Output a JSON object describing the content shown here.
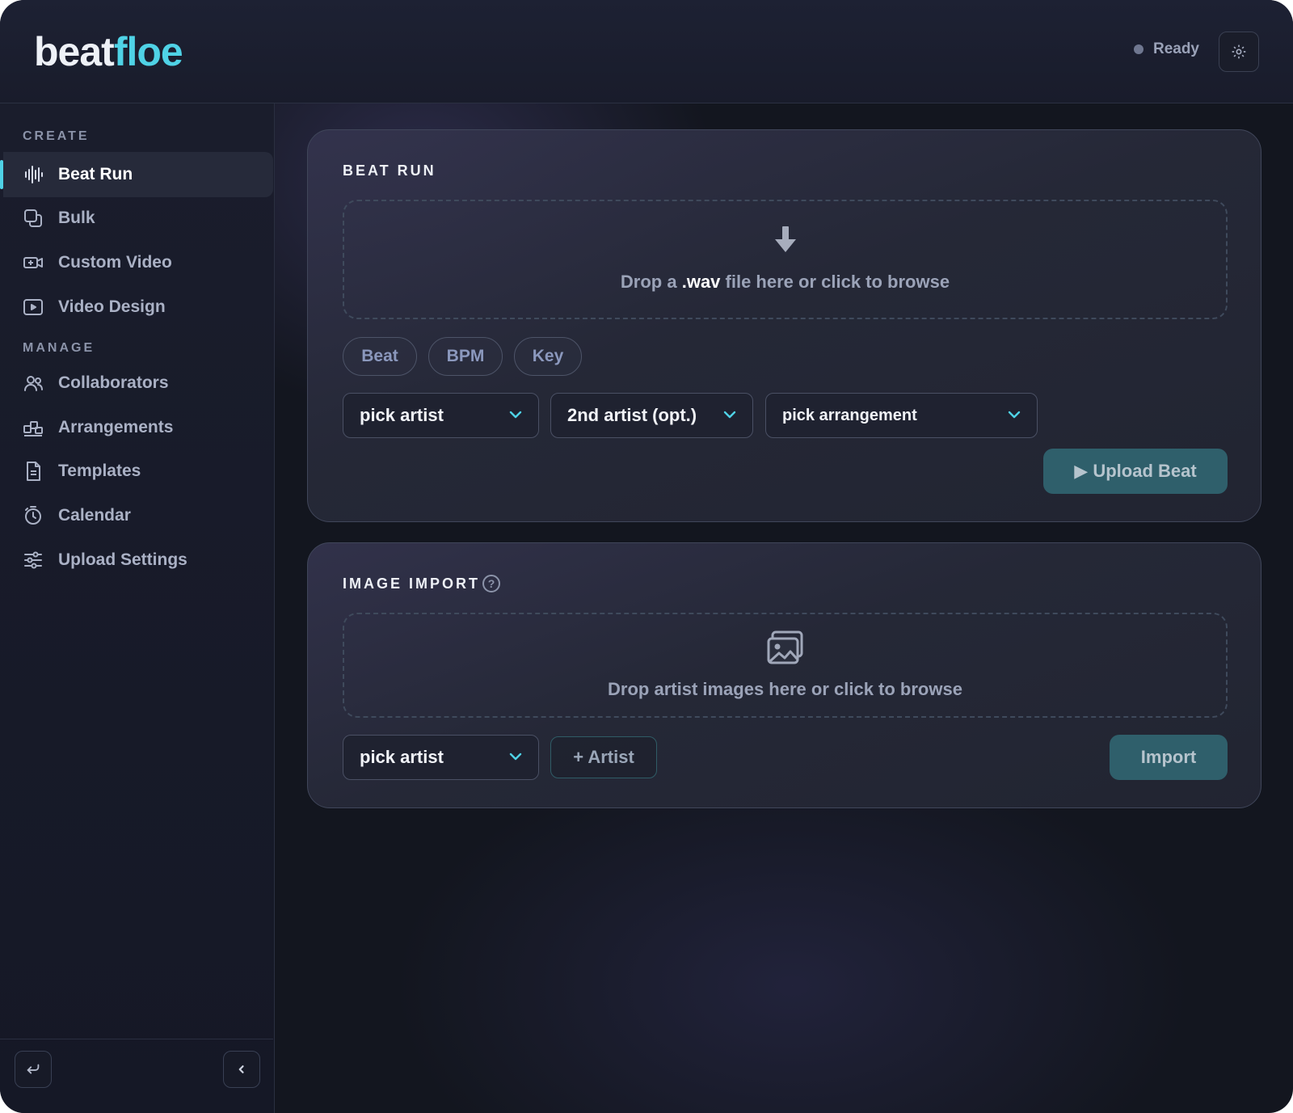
{
  "header": {
    "logo_part1": "beat",
    "logo_part2": "floe",
    "status": "Ready",
    "settings_icon": "gear-icon"
  },
  "sidebar": {
    "create_label": "CREATE",
    "manage_label": "MANAGE",
    "items": [
      {
        "label": "Beat Run",
        "icon": "waveform-icon"
      },
      {
        "label": "Bulk",
        "icon": "copy-icon"
      },
      {
        "label": "Custom Video",
        "icon": "video-camera-icon"
      },
      {
        "label": "Video Design",
        "icon": "play-screen-icon"
      },
      {
        "label": "Collaborators",
        "icon": "users-icon"
      },
      {
        "label": "Arrangements",
        "icon": "blocks-icon"
      },
      {
        "label": "Templates",
        "icon": "document-icon"
      },
      {
        "label": "Calendar",
        "icon": "timer-icon"
      },
      {
        "label": "Upload Settings",
        "icon": "sliders-icon"
      }
    ],
    "footer": {
      "back_icon": "return-icon",
      "collapse_icon": "chevron-left-icon"
    }
  },
  "beat_run": {
    "title": "BEAT RUN",
    "drop_prefix": "Drop a ",
    "drop_highlight": ".wav",
    "drop_suffix": " file here or click to browse",
    "chips": [
      "Beat",
      "BPM",
      "Key"
    ],
    "artist_select": "pick artist",
    "second_artist_select": "2nd artist (opt.)",
    "arrangement_select": "pick arrangement",
    "upload_button": "▶ Upload Beat"
  },
  "image_import": {
    "title": "IMAGE IMPORT",
    "help": "?",
    "drop_text": "Drop artist images here or click to browse",
    "artist_select": "pick artist",
    "add_artist_button": "+ Artist",
    "import_button": "Import"
  },
  "colors": {
    "accent": "#4fd2e6",
    "button": "#2f5f6b",
    "background": "#13161f"
  }
}
